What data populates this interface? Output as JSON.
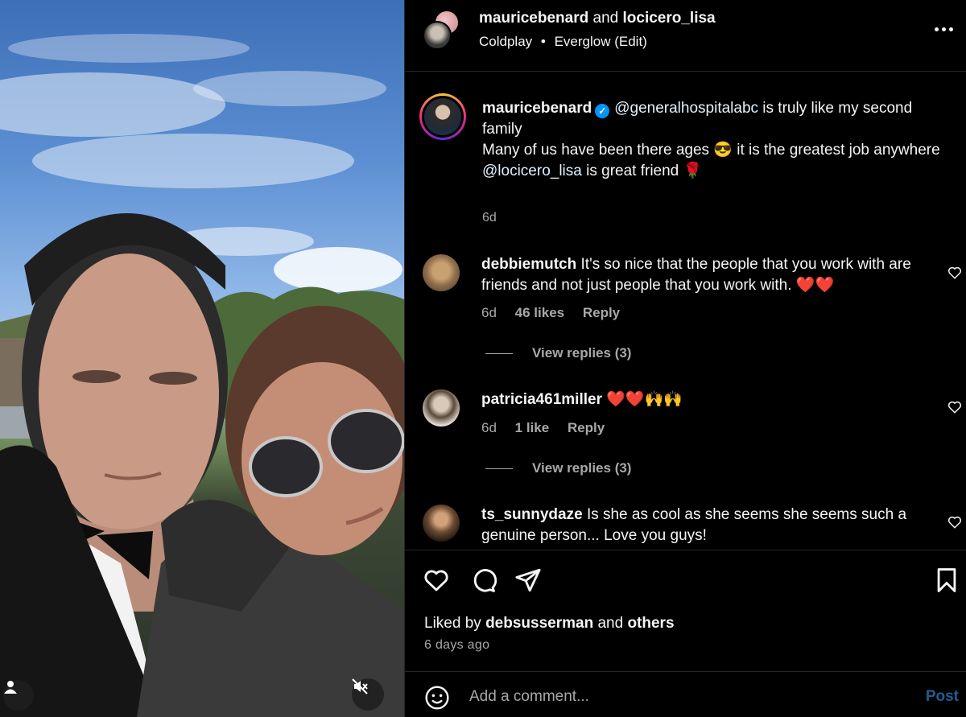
{
  "header": {
    "user1": "mauricebenard",
    "connector": "and",
    "user2": "locicero_lisa",
    "artist": "Coldplay",
    "separator": "•",
    "song": "Everglow (Edit)"
  },
  "caption": {
    "username": "mauricebenard",
    "verified_mark": "✓",
    "mention1": "@generalhospitalabc",
    "text1": " is truly like my second family",
    "line2": "Many of us have been there ages 😎 it is the greatest job anywhere",
    "mention2": "@locicero_lisa",
    "text3": " is great friend 🌹",
    "time": "6d"
  },
  "comments": [
    {
      "username": "debbiemutch",
      "text": "It's so nice that the people that you work with are friends and not just people that you work with. ❤️❤️",
      "time": "6d",
      "likes": "46 likes",
      "reply": "Reply",
      "view_replies": "View replies (3)"
    },
    {
      "username": "patricia461miller",
      "text": "❤️❤️🙌🙌",
      "time": "6d",
      "likes": "1 like",
      "reply": "Reply",
      "view_replies": "View replies (3)"
    },
    {
      "username": "ts_sunnydaze",
      "text": "Is she as cool as she seems she seems such a genuine person... Love you guys!"
    }
  ],
  "actions": {
    "liked_prefix": "Liked by",
    "liked_user": "debsusserman",
    "liked_and": "and",
    "liked_others": "others",
    "time_ago": "6 days ago"
  },
  "add_comment": {
    "placeholder": "Add a comment...",
    "post_label": "Post"
  },
  "icons": {
    "like": "heart-icon",
    "comment": "comment-icon",
    "share": "send-icon",
    "save": "bookmark-icon",
    "emoji": "emoji-icon",
    "more": "more-icon",
    "mute": "mute-icon",
    "tagged": "user-icon"
  },
  "colors": {
    "background": "#000000",
    "text": "#f5f5f5",
    "muted": "#a8a8a8",
    "verified": "#0095f6",
    "post_button": "#1f5f8f"
  }
}
